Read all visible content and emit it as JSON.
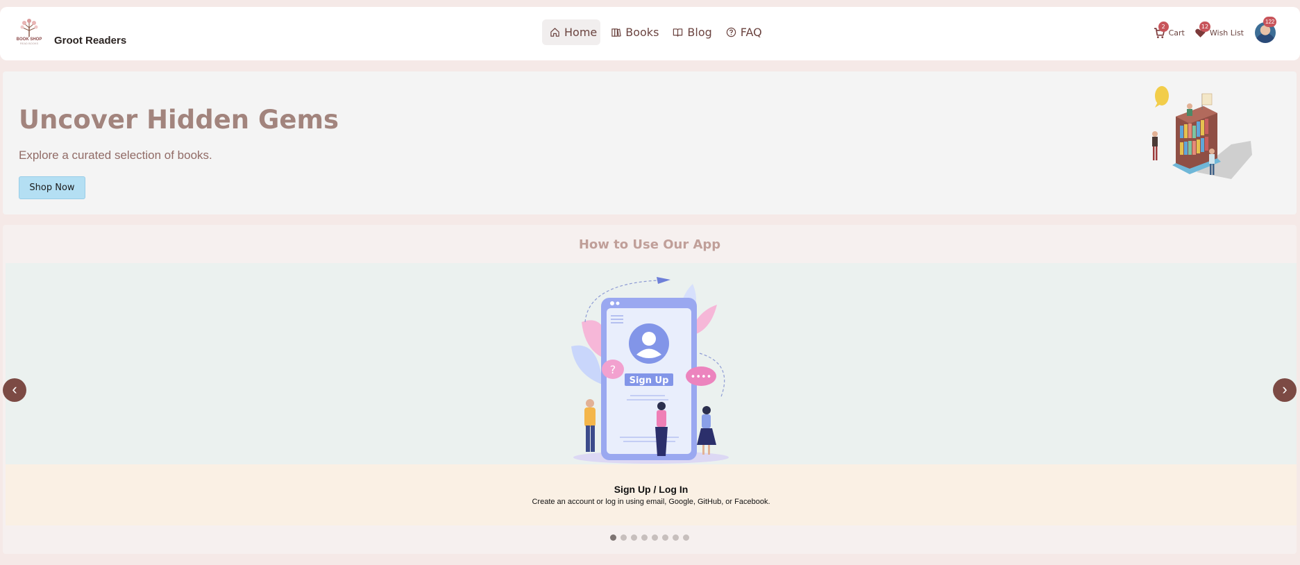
{
  "brand": {
    "name": "Groot Readers",
    "logo_text": "BOOK SHOP",
    "logo_sub": "READ BOOKS"
  },
  "nav": {
    "links": [
      {
        "label": "Home",
        "icon": "home-icon",
        "active": true
      },
      {
        "label": "Books",
        "icon": "books-icon",
        "active": false
      },
      {
        "label": "Blog",
        "icon": "open-book-icon",
        "active": false
      },
      {
        "label": "FAQ",
        "icon": "question-circle-icon",
        "active": false
      }
    ],
    "cart": {
      "label": "Cart",
      "count": "2"
    },
    "wishlist": {
      "label": "Wish List",
      "count": "12"
    },
    "profile": {
      "count": "122"
    }
  },
  "hero": {
    "title": "Uncover Hidden Gems",
    "subtitle": "Explore a curated selection of books.",
    "button": "Shop Now"
  },
  "howto": {
    "title": "How to Use Our App",
    "slide_illustration_text": "Sign Up",
    "slide": {
      "title": "Sign Up / Log In",
      "text": "Create an account or log in using email, Google, GitHub, or Facebook."
    },
    "prev_arrow": "‹",
    "next_arrow": "›",
    "dots_count": 8,
    "active_dot": 0
  },
  "colors": {
    "page_bg": "#f5e9e7",
    "accent": "#7c4a44",
    "hero_title": "#a2847d",
    "button_bg": "#b4dff3",
    "badge": "#c8545a"
  }
}
